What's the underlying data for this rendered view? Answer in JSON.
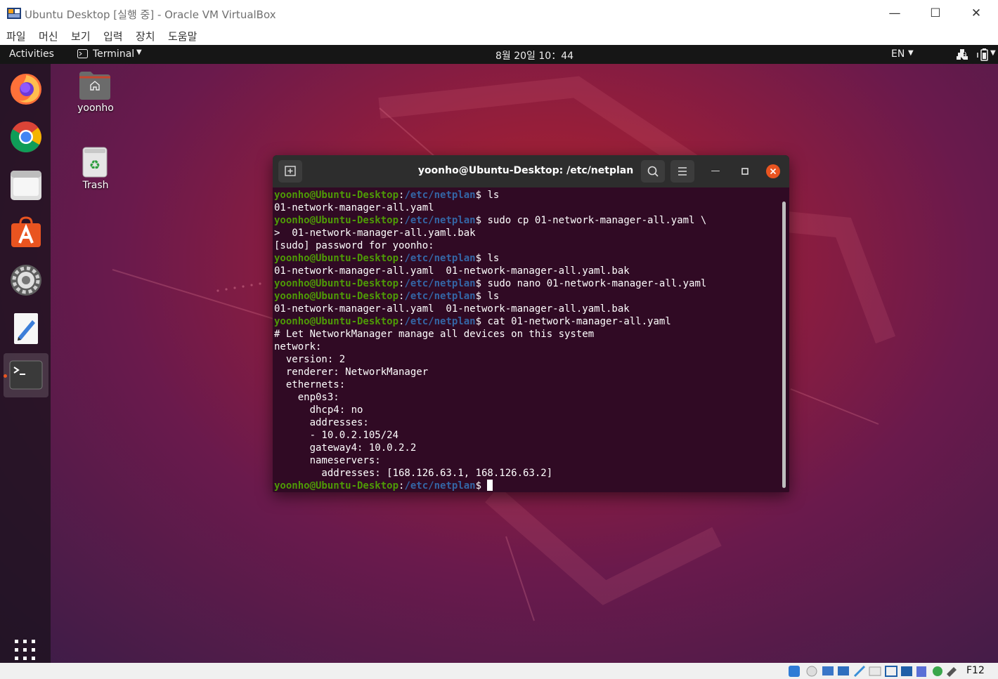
{
  "host_window": {
    "title": "Ubuntu Desktop [실행 중] - Oracle VM VirtualBox",
    "controls": [
      "minimize",
      "maximize",
      "close"
    ],
    "menu": [
      "파일",
      "머신",
      "보기",
      "입력",
      "장치",
      "도움말"
    ]
  },
  "topbar": {
    "activities": "Activities",
    "app_menu": "Terminal",
    "clock": "8월 20일  10：44",
    "input_method": "EN"
  },
  "desktop_icons": [
    {
      "label": "yoonho",
      "icon": "home-folder-icon"
    },
    {
      "label": "Trash",
      "icon": "trash-icon"
    }
  ],
  "dock": [
    {
      "name": "Firefox",
      "icon": "firefox-icon"
    },
    {
      "name": "Chrome",
      "icon": "chrome-icon"
    },
    {
      "name": "Files",
      "icon": "files-icon"
    },
    {
      "name": "Ubuntu Software",
      "icon": "software-icon"
    },
    {
      "name": "Settings",
      "icon": "settings-icon"
    },
    {
      "name": "Text Editor",
      "icon": "text-editor-icon"
    },
    {
      "name": "Terminal",
      "icon": "terminal-icon",
      "active": true
    }
  ],
  "terminal": {
    "title": "yoonho@Ubuntu-Desktop: /etc/netplan",
    "prompt_user": "yoonho@Ubuntu-Desktop",
    "prompt_path": "/etc/netplan",
    "lines": [
      {
        "type": "cmd",
        "text": "ls"
      },
      {
        "type": "out",
        "text": "01-network-manager-all.yaml"
      },
      {
        "type": "cmd",
        "text": "sudo cp 01-network-manager-all.yaml \\"
      },
      {
        "type": "out",
        "text": ">  01-network-manager-all.yaml.bak"
      },
      {
        "type": "out",
        "text": "[sudo] password for yoonho:"
      },
      {
        "type": "cmd",
        "text": "ls"
      },
      {
        "type": "out",
        "text": "01-network-manager-all.yaml  01-network-manager-all.yaml.bak"
      },
      {
        "type": "cmd",
        "text": "sudo nano 01-network-manager-all.yaml"
      },
      {
        "type": "cmd",
        "text": "ls"
      },
      {
        "type": "out",
        "text": "01-network-manager-all.yaml  01-network-manager-all.yaml.bak"
      },
      {
        "type": "cmd",
        "text": "cat 01-network-manager-all.yaml"
      },
      {
        "type": "out",
        "text": "# Let NetworkManager manage all devices on this system"
      },
      {
        "type": "out",
        "text": "network:"
      },
      {
        "type": "out",
        "text": "  version: 2"
      },
      {
        "type": "out",
        "text": "  renderer: NetworkManager"
      },
      {
        "type": "out",
        "text": "  ethernets:"
      },
      {
        "type": "out",
        "text": "    enp0s3:"
      },
      {
        "type": "out",
        "text": "      dhcp4: no"
      },
      {
        "type": "out",
        "text": "      addresses:"
      },
      {
        "type": "out",
        "text": "      - 10.0.2.105/24"
      },
      {
        "type": "out",
        "text": "      gateway4: 10.0.2.2"
      },
      {
        "type": "out",
        "text": "      nameservers:"
      },
      {
        "type": "out",
        "text": "        addresses: [168.126.63.1, 168.126.63.2]"
      },
      {
        "type": "cmd",
        "text": ""
      }
    ]
  },
  "status_bar": {
    "host_key": "F12"
  },
  "colors": {
    "terminal_bg": "#300a24",
    "prompt_user": "#4e9a06",
    "prompt_path": "#3465a4",
    "close_button": "#e95420"
  }
}
